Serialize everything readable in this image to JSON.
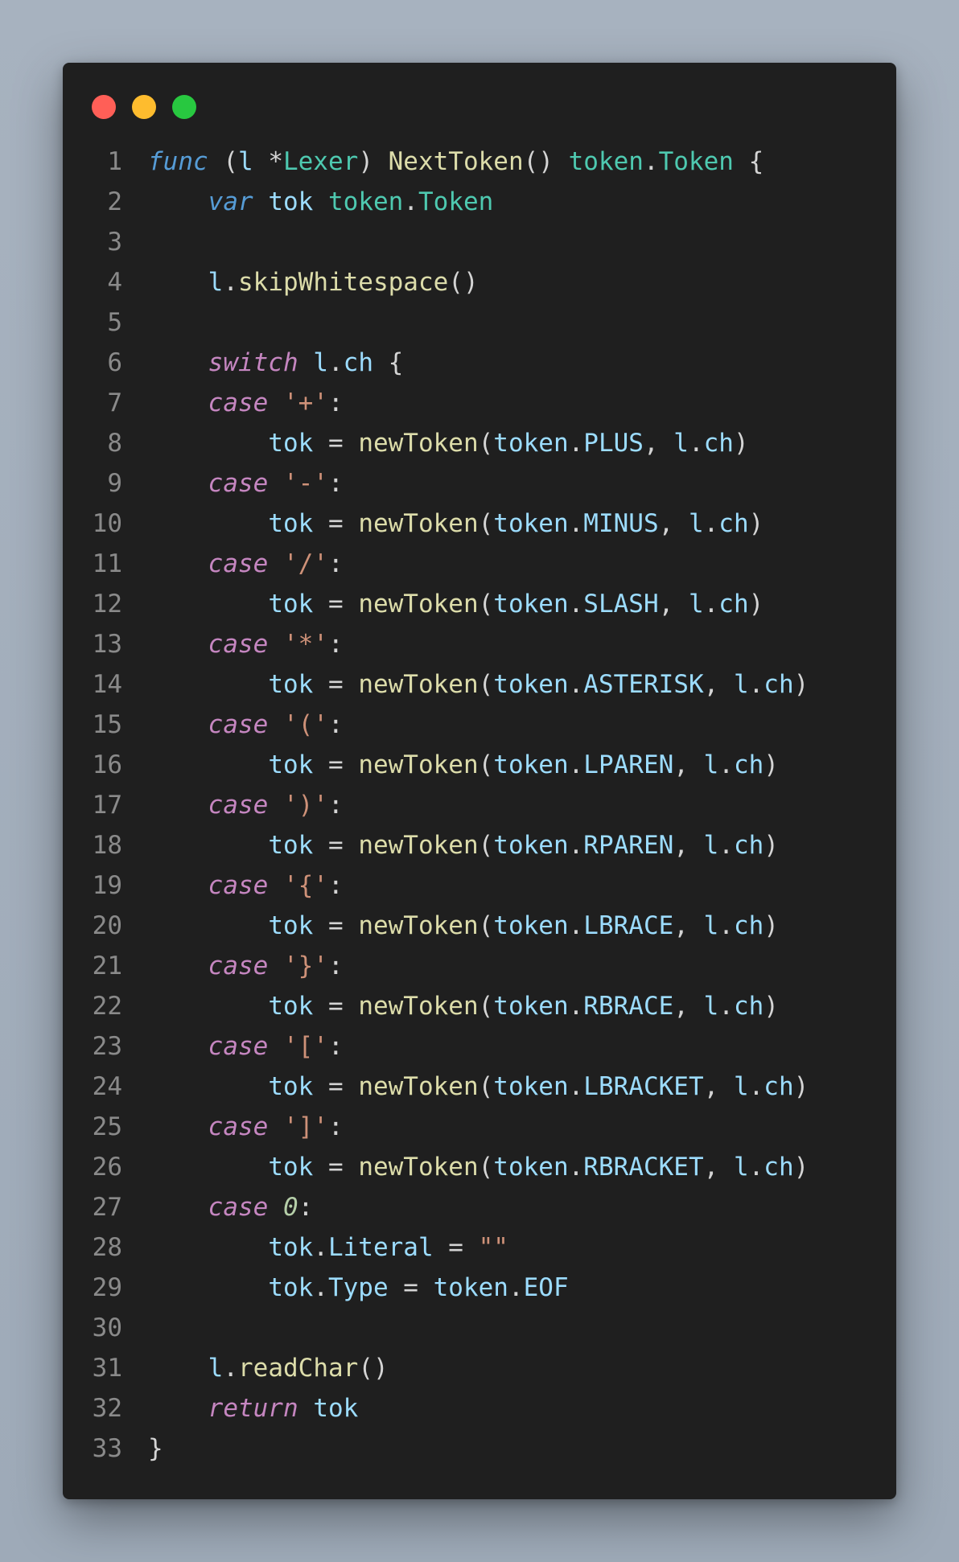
{
  "window": {
    "buttons": [
      {
        "name": "close",
        "color": "#ff5f57"
      },
      {
        "name": "minimize",
        "color": "#febc2e"
      },
      {
        "name": "zoom",
        "color": "#28c840"
      }
    ]
  },
  "code": {
    "language": "go",
    "lines": [
      {
        "n": "1",
        "tokens": [
          [
            "kw",
            "func"
          ],
          [
            "pun",
            " ("
          ],
          [
            "var",
            "l"
          ],
          [
            "pun",
            " *"
          ],
          [
            "type",
            "Lexer"
          ],
          [
            "pun",
            ") "
          ],
          [
            "fn",
            "NextToken"
          ],
          [
            "pun",
            "() "
          ],
          [
            "type",
            "token"
          ],
          [
            "pun",
            "."
          ],
          [
            "type",
            "Token"
          ],
          [
            "pun",
            " {"
          ]
        ]
      },
      {
        "n": "2",
        "tokens": [
          [
            "pun",
            "    "
          ],
          [
            "kw",
            "var"
          ],
          [
            "pun",
            " "
          ],
          [
            "var",
            "tok"
          ],
          [
            "pun",
            " "
          ],
          [
            "type",
            "token"
          ],
          [
            "pun",
            "."
          ],
          [
            "type",
            "Token"
          ]
        ]
      },
      {
        "n": "3",
        "tokens": []
      },
      {
        "n": "4",
        "tokens": [
          [
            "pun",
            "    "
          ],
          [
            "var",
            "l"
          ],
          [
            "pun",
            "."
          ],
          [
            "fn",
            "skipWhitespace"
          ],
          [
            "pun",
            "()"
          ]
        ]
      },
      {
        "n": "5",
        "tokens": []
      },
      {
        "n": "6",
        "tokens": [
          [
            "pun",
            "    "
          ],
          [
            "ctl",
            "switch"
          ],
          [
            "pun",
            " "
          ],
          [
            "var",
            "l"
          ],
          [
            "pun",
            "."
          ],
          [
            "var",
            "ch"
          ],
          [
            "pun",
            " {"
          ]
        ]
      },
      {
        "n": "7",
        "tokens": [
          [
            "pun",
            "    "
          ],
          [
            "ctl",
            "case"
          ],
          [
            "pun",
            " "
          ],
          [
            "str",
            "'+'"
          ],
          [
            "pun",
            ":"
          ]
        ]
      },
      {
        "n": "8",
        "tokens": [
          [
            "pun",
            "        "
          ],
          [
            "var",
            "tok"
          ],
          [
            "pun",
            " = "
          ],
          [
            "fn",
            "newToken"
          ],
          [
            "pun",
            "("
          ],
          [
            "var",
            "token"
          ],
          [
            "pun",
            "."
          ],
          [
            "var",
            "PLUS"
          ],
          [
            "pun",
            ", "
          ],
          [
            "var",
            "l"
          ],
          [
            "pun",
            "."
          ],
          [
            "var",
            "ch"
          ],
          [
            "pun",
            ")"
          ]
        ]
      },
      {
        "n": "9",
        "tokens": [
          [
            "pun",
            "    "
          ],
          [
            "ctl",
            "case"
          ],
          [
            "pun",
            " "
          ],
          [
            "str",
            "'-'"
          ],
          [
            "pun",
            ":"
          ]
        ]
      },
      {
        "n": "10",
        "tokens": [
          [
            "pun",
            "        "
          ],
          [
            "var",
            "tok"
          ],
          [
            "pun",
            " = "
          ],
          [
            "fn",
            "newToken"
          ],
          [
            "pun",
            "("
          ],
          [
            "var",
            "token"
          ],
          [
            "pun",
            "."
          ],
          [
            "var",
            "MINUS"
          ],
          [
            "pun",
            ", "
          ],
          [
            "var",
            "l"
          ],
          [
            "pun",
            "."
          ],
          [
            "var",
            "ch"
          ],
          [
            "pun",
            ")"
          ]
        ]
      },
      {
        "n": "11",
        "tokens": [
          [
            "pun",
            "    "
          ],
          [
            "ctl",
            "case"
          ],
          [
            "pun",
            " "
          ],
          [
            "str",
            "'/'"
          ],
          [
            "pun",
            ":"
          ]
        ]
      },
      {
        "n": "12",
        "tokens": [
          [
            "pun",
            "        "
          ],
          [
            "var",
            "tok"
          ],
          [
            "pun",
            " = "
          ],
          [
            "fn",
            "newToken"
          ],
          [
            "pun",
            "("
          ],
          [
            "var",
            "token"
          ],
          [
            "pun",
            "."
          ],
          [
            "var",
            "SLASH"
          ],
          [
            "pun",
            ", "
          ],
          [
            "var",
            "l"
          ],
          [
            "pun",
            "."
          ],
          [
            "var",
            "ch"
          ],
          [
            "pun",
            ")"
          ]
        ]
      },
      {
        "n": "13",
        "tokens": [
          [
            "pun",
            "    "
          ],
          [
            "ctl",
            "case"
          ],
          [
            "pun",
            " "
          ],
          [
            "str",
            "'*'"
          ],
          [
            "pun",
            ":"
          ]
        ]
      },
      {
        "n": "14",
        "tokens": [
          [
            "pun",
            "        "
          ],
          [
            "var",
            "tok"
          ],
          [
            "pun",
            " = "
          ],
          [
            "fn",
            "newToken"
          ],
          [
            "pun",
            "("
          ],
          [
            "var",
            "token"
          ],
          [
            "pun",
            "."
          ],
          [
            "var",
            "ASTERISK"
          ],
          [
            "pun",
            ", "
          ],
          [
            "var",
            "l"
          ],
          [
            "pun",
            "."
          ],
          [
            "var",
            "ch"
          ],
          [
            "pun",
            ")"
          ]
        ]
      },
      {
        "n": "15",
        "tokens": [
          [
            "pun",
            "    "
          ],
          [
            "ctl",
            "case"
          ],
          [
            "pun",
            " "
          ],
          [
            "str",
            "'('"
          ],
          [
            "pun",
            ":"
          ]
        ]
      },
      {
        "n": "16",
        "tokens": [
          [
            "pun",
            "        "
          ],
          [
            "var",
            "tok"
          ],
          [
            "pun",
            " = "
          ],
          [
            "fn",
            "newToken"
          ],
          [
            "pun",
            "("
          ],
          [
            "var",
            "token"
          ],
          [
            "pun",
            "."
          ],
          [
            "var",
            "LPAREN"
          ],
          [
            "pun",
            ", "
          ],
          [
            "var",
            "l"
          ],
          [
            "pun",
            "."
          ],
          [
            "var",
            "ch"
          ],
          [
            "pun",
            ")"
          ]
        ]
      },
      {
        "n": "17",
        "tokens": [
          [
            "pun",
            "    "
          ],
          [
            "ctl",
            "case"
          ],
          [
            "pun",
            " "
          ],
          [
            "str",
            "')'"
          ],
          [
            "pun",
            ":"
          ]
        ]
      },
      {
        "n": "18",
        "tokens": [
          [
            "pun",
            "        "
          ],
          [
            "var",
            "tok"
          ],
          [
            "pun",
            " = "
          ],
          [
            "fn",
            "newToken"
          ],
          [
            "pun",
            "("
          ],
          [
            "var",
            "token"
          ],
          [
            "pun",
            "."
          ],
          [
            "var",
            "RPAREN"
          ],
          [
            "pun",
            ", "
          ],
          [
            "var",
            "l"
          ],
          [
            "pun",
            "."
          ],
          [
            "var",
            "ch"
          ],
          [
            "pun",
            ")"
          ]
        ]
      },
      {
        "n": "19",
        "tokens": [
          [
            "pun",
            "    "
          ],
          [
            "ctl",
            "case"
          ],
          [
            "pun",
            " "
          ],
          [
            "str",
            "'{'"
          ],
          [
            "pun",
            ":"
          ]
        ]
      },
      {
        "n": "20",
        "tokens": [
          [
            "pun",
            "        "
          ],
          [
            "var",
            "tok"
          ],
          [
            "pun",
            " = "
          ],
          [
            "fn",
            "newToken"
          ],
          [
            "pun",
            "("
          ],
          [
            "var",
            "token"
          ],
          [
            "pun",
            "."
          ],
          [
            "var",
            "LBRACE"
          ],
          [
            "pun",
            ", "
          ],
          [
            "var",
            "l"
          ],
          [
            "pun",
            "."
          ],
          [
            "var",
            "ch"
          ],
          [
            "pun",
            ")"
          ]
        ]
      },
      {
        "n": "21",
        "tokens": [
          [
            "pun",
            "    "
          ],
          [
            "ctl",
            "case"
          ],
          [
            "pun",
            " "
          ],
          [
            "str",
            "'}'"
          ],
          [
            "pun",
            ":"
          ]
        ]
      },
      {
        "n": "22",
        "tokens": [
          [
            "pun",
            "        "
          ],
          [
            "var",
            "tok"
          ],
          [
            "pun",
            " = "
          ],
          [
            "fn",
            "newToken"
          ],
          [
            "pun",
            "("
          ],
          [
            "var",
            "token"
          ],
          [
            "pun",
            "."
          ],
          [
            "var",
            "RBRACE"
          ],
          [
            "pun",
            ", "
          ],
          [
            "var",
            "l"
          ],
          [
            "pun",
            "."
          ],
          [
            "var",
            "ch"
          ],
          [
            "pun",
            ")"
          ]
        ]
      },
      {
        "n": "23",
        "tokens": [
          [
            "pun",
            "    "
          ],
          [
            "ctl",
            "case"
          ],
          [
            "pun",
            " "
          ],
          [
            "str",
            "'['"
          ],
          [
            "pun",
            ":"
          ]
        ]
      },
      {
        "n": "24",
        "tokens": [
          [
            "pun",
            "        "
          ],
          [
            "var",
            "tok"
          ],
          [
            "pun",
            " = "
          ],
          [
            "fn",
            "newToken"
          ],
          [
            "pun",
            "("
          ],
          [
            "var",
            "token"
          ],
          [
            "pun",
            "."
          ],
          [
            "var",
            "LBRACKET"
          ],
          [
            "pun",
            ", "
          ],
          [
            "var",
            "l"
          ],
          [
            "pun",
            "."
          ],
          [
            "var",
            "ch"
          ],
          [
            "pun",
            ")"
          ]
        ]
      },
      {
        "n": "25",
        "tokens": [
          [
            "pun",
            "    "
          ],
          [
            "ctl",
            "case"
          ],
          [
            "pun",
            " "
          ],
          [
            "str",
            "']'"
          ],
          [
            "pun",
            ":"
          ]
        ]
      },
      {
        "n": "26",
        "tokens": [
          [
            "pun",
            "        "
          ],
          [
            "var",
            "tok"
          ],
          [
            "pun",
            " = "
          ],
          [
            "fn",
            "newToken"
          ],
          [
            "pun",
            "("
          ],
          [
            "var",
            "token"
          ],
          [
            "pun",
            "."
          ],
          [
            "var",
            "RBRACKET"
          ],
          [
            "pun",
            ", "
          ],
          [
            "var",
            "l"
          ],
          [
            "pun",
            "."
          ],
          [
            "var",
            "ch"
          ],
          [
            "pun",
            ")"
          ]
        ]
      },
      {
        "n": "27",
        "tokens": [
          [
            "pun",
            "    "
          ],
          [
            "ctl",
            "case"
          ],
          [
            "pun",
            " "
          ],
          [
            "num",
            "0"
          ],
          [
            "pun",
            ":"
          ]
        ]
      },
      {
        "n": "28",
        "tokens": [
          [
            "pun",
            "        "
          ],
          [
            "var",
            "tok"
          ],
          [
            "pun",
            "."
          ],
          [
            "var",
            "Literal"
          ],
          [
            "pun",
            " = "
          ],
          [
            "str",
            "\"\""
          ]
        ]
      },
      {
        "n": "29",
        "tokens": [
          [
            "pun",
            "        "
          ],
          [
            "var",
            "tok"
          ],
          [
            "pun",
            "."
          ],
          [
            "var",
            "Type"
          ],
          [
            "pun",
            " = "
          ],
          [
            "var",
            "token"
          ],
          [
            "pun",
            "."
          ],
          [
            "var",
            "EOF"
          ]
        ]
      },
      {
        "n": "30",
        "tokens": []
      },
      {
        "n": "31",
        "tokens": [
          [
            "pun",
            "    "
          ],
          [
            "var",
            "l"
          ],
          [
            "pun",
            "."
          ],
          [
            "fn",
            "readChar"
          ],
          [
            "pun",
            "()"
          ]
        ]
      },
      {
        "n": "32",
        "tokens": [
          [
            "pun",
            "    "
          ],
          [
            "ctl",
            "return"
          ],
          [
            "pun",
            " "
          ],
          [
            "var",
            "tok"
          ]
        ]
      },
      {
        "n": "33",
        "tokens": [
          [
            "pun",
            "}"
          ]
        ]
      }
    ]
  }
}
